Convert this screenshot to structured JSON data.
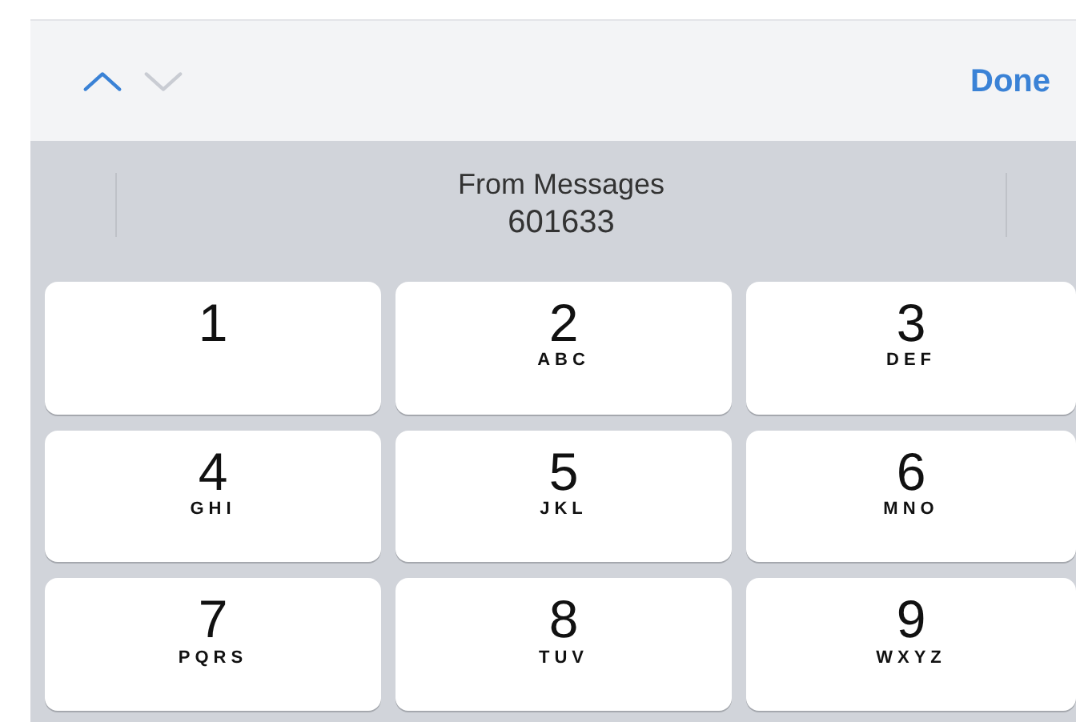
{
  "toolbar": {
    "arrows": [
      {
        "kind": "up",
        "disabled": false
      },
      {
        "kind": "down",
        "disabled": true
      }
    ],
    "done": "Done"
  },
  "suggestion": {
    "source": "From Messages",
    "code": "601633"
  },
  "keys": [
    {
      "digit": "1"
    },
    {
      "digit": "2",
      "letters": "ABC"
    },
    {
      "digit": "3",
      "letters": "DEF"
    },
    {
      "digit": "4",
      "letters": "GHI"
    },
    {
      "digit": "5",
      "letters": "JKL"
    },
    {
      "digit": "6",
      "letters": "MNO"
    },
    {
      "digit": "7",
      "letters": "PQRS"
    },
    {
      "digit": "8",
      "letters": "TUV"
    },
    {
      "digit": "9",
      "letters": "WXYZ"
    }
  ]
}
